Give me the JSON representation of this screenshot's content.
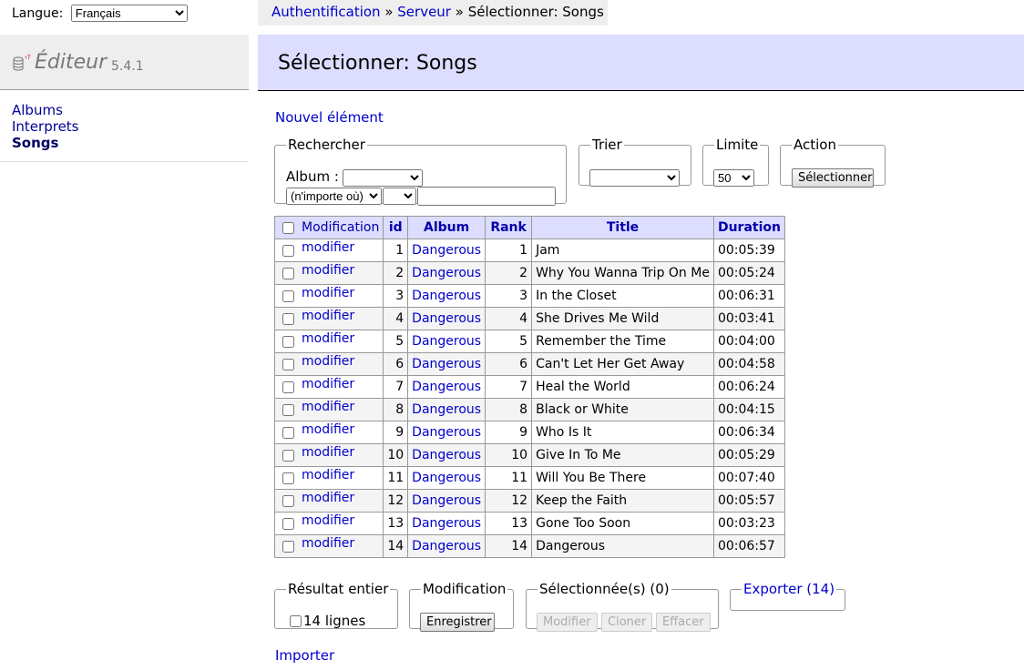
{
  "language": {
    "label": "Langue:",
    "selected": "Français"
  },
  "breadcrumb": {
    "link1": "Authentification",
    "sep1": " » ",
    "link2": "Serveur",
    "sep2": " » ",
    "current": "Sélectionner: Songs"
  },
  "app": {
    "title": "Éditeur",
    "version": "5.4.1"
  },
  "sidebar": {
    "items": [
      {
        "label": "Albums"
      },
      {
        "label": "Interprets"
      },
      {
        "label": "Songs"
      }
    ]
  },
  "page": {
    "title": "Sélectionner: Songs",
    "new_item": "Nouvel élément"
  },
  "search": {
    "legend": "Rechercher",
    "album_label": "Album :",
    "album_value": "",
    "where_value": "(n'importe où)",
    "op_value": "",
    "text_value": ""
  },
  "sort": {
    "legend": "Trier",
    "value": ""
  },
  "limit": {
    "legend": "Limite",
    "value": "50"
  },
  "action": {
    "legend": "Action",
    "button": "Sélectionner"
  },
  "table": {
    "headers": [
      "Modification",
      "id",
      "Album",
      "Rank",
      "Title",
      "Duration"
    ],
    "edit_label": "modifier",
    "rows": [
      {
        "id": "1",
        "album": "Dangerous",
        "rank": "1",
        "title": "Jam",
        "duration": "00:05:39"
      },
      {
        "id": "2",
        "album": "Dangerous",
        "rank": "2",
        "title": "Why You Wanna Trip On Me",
        "duration": "00:05:24"
      },
      {
        "id": "3",
        "album": "Dangerous",
        "rank": "3",
        "title": "In the Closet",
        "duration": "00:06:31"
      },
      {
        "id": "4",
        "album": "Dangerous",
        "rank": "4",
        "title": "She Drives Me Wild",
        "duration": "00:03:41"
      },
      {
        "id": "5",
        "album": "Dangerous",
        "rank": "5",
        "title": "Remember the Time",
        "duration": "00:04:00"
      },
      {
        "id": "6",
        "album": "Dangerous",
        "rank": "6",
        "title": "Can't Let Her Get Away",
        "duration": "00:04:58"
      },
      {
        "id": "7",
        "album": "Dangerous",
        "rank": "7",
        "title": "Heal the World",
        "duration": "00:06:24"
      },
      {
        "id": "8",
        "album": "Dangerous",
        "rank": "8",
        "title": "Black or White",
        "duration": "00:04:15"
      },
      {
        "id": "9",
        "album": "Dangerous",
        "rank": "9",
        "title": "Who Is It",
        "duration": "00:06:34"
      },
      {
        "id": "10",
        "album": "Dangerous",
        "rank": "10",
        "title": "Give In To Me",
        "duration": "00:05:29"
      },
      {
        "id": "11",
        "album": "Dangerous",
        "rank": "11",
        "title": "Will You Be There",
        "duration": "00:07:40"
      },
      {
        "id": "12",
        "album": "Dangerous",
        "rank": "12",
        "title": "Keep the Faith",
        "duration": "00:05:57"
      },
      {
        "id": "13",
        "album": "Dangerous",
        "rank": "13",
        "title": "Gone Too Soon",
        "duration": "00:03:23"
      },
      {
        "id": "14",
        "album": "Dangerous",
        "rank": "14",
        "title": "Dangerous",
        "duration": "00:06:57"
      }
    ]
  },
  "footer": {
    "result_legend": "Résultat entier",
    "result_count": "14 lignes",
    "modif_legend": "Modification",
    "save_button": "Enregistrer",
    "selected_legend": "Sélectionnée(s) (0)",
    "btn_modify": "Modifier",
    "btn_clone": "Cloner",
    "btn_delete": "Effacer",
    "export_label": "Exporter (14)",
    "import_label": "Importer"
  }
}
